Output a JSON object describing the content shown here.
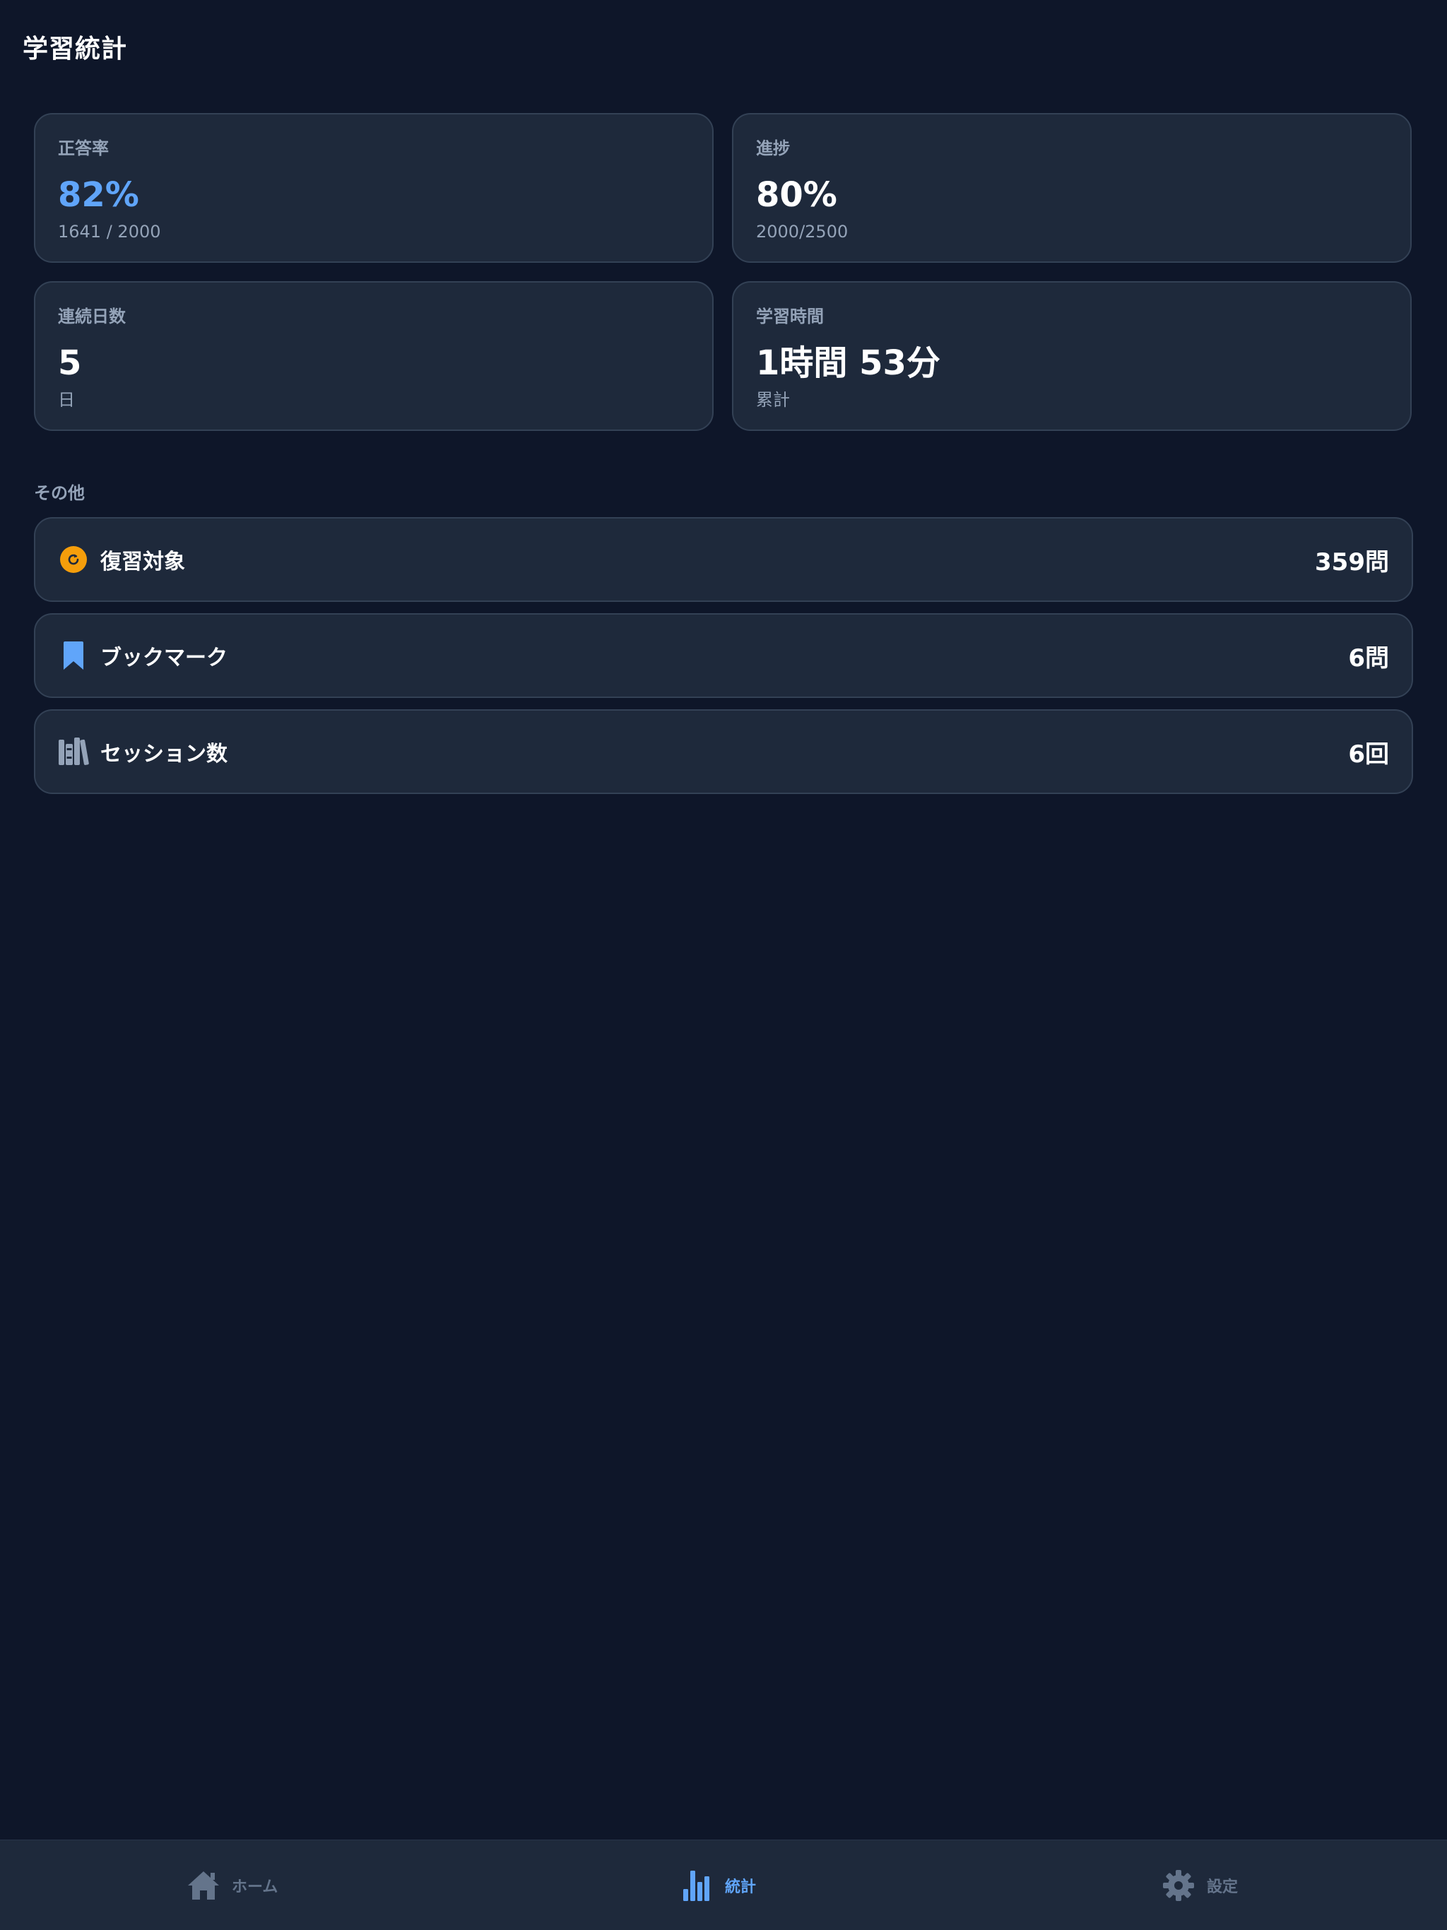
{
  "header": {
    "title": "学習統計"
  },
  "stats": {
    "accuracy": {
      "label": "正答率",
      "value": "82%",
      "sub": "1641 / 2000"
    },
    "progress": {
      "label": "進捗",
      "value": "80%",
      "sub": "2000/2500"
    },
    "streak": {
      "label": "連続日数",
      "value": "5",
      "sub": "日"
    },
    "study_time": {
      "label": "学習時間",
      "value": "1時間 53分",
      "sub": "累計"
    }
  },
  "other": {
    "section_label": "その他",
    "items": [
      {
        "label": "復習対象",
        "value": "359問",
        "icon": "refresh-icon"
      },
      {
        "label": "ブックマーク",
        "value": "6問",
        "icon": "bookmark-icon"
      },
      {
        "label": "セッション数",
        "value": "6回",
        "icon": "books-icon"
      }
    ]
  },
  "tabbar": {
    "active": "stats",
    "items": [
      {
        "label": "ホーム",
        "icon": "home-icon"
      },
      {
        "label": "統計",
        "icon": "bar-chart-icon"
      },
      {
        "label": "設定",
        "icon": "gear-icon"
      }
    ]
  },
  "colors": {
    "background": "#0e1629",
    "card": "#1e293b",
    "border": "#334155",
    "accent": "#60a5fa",
    "muted": "#94a3b8",
    "review": "#f59e0b"
  }
}
